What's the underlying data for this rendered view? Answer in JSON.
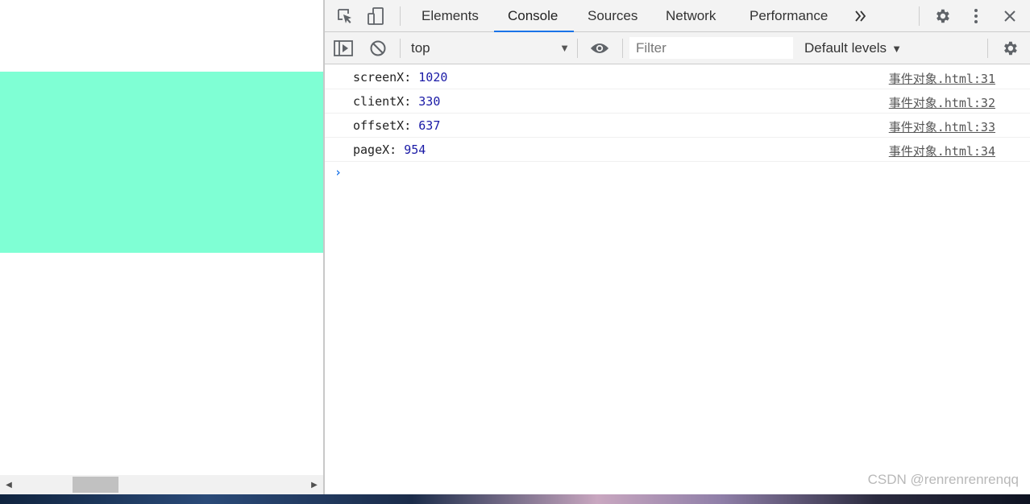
{
  "devtools": {
    "tabs": [
      "Elements",
      "Console",
      "Sources",
      "Network",
      "Performance"
    ],
    "active_tab": "Console",
    "icons": {
      "inspect": "inspect-element-icon",
      "device": "device-toolbar-icon",
      "more_tabs": "more-tabs-icon",
      "settings": "settings-gear-icon",
      "menu": "kebab-menu-icon",
      "close": "close-icon"
    }
  },
  "console_toolbar": {
    "context": "top",
    "filter_placeholder": "Filter",
    "levels": "Default levels"
  },
  "logs": [
    {
      "label": "screenX: ",
      "value": "1020",
      "source": "事件对象.html:31"
    },
    {
      "label": "clientX: ",
      "value": "330",
      "source": "事件对象.html:32"
    },
    {
      "label": "offsetX: ",
      "value": "637",
      "source": "事件对象.html:33"
    },
    {
      "label": "pageX: ",
      "value": "954",
      "source": "事件对象.html:34"
    }
  ],
  "prompt_symbol": "›",
  "watermark": "CSDN @renrenrenrenqq",
  "colors": {
    "demo_box": "#7fffd4",
    "accent": "#1a73e8",
    "value": "#1a1aa6"
  }
}
